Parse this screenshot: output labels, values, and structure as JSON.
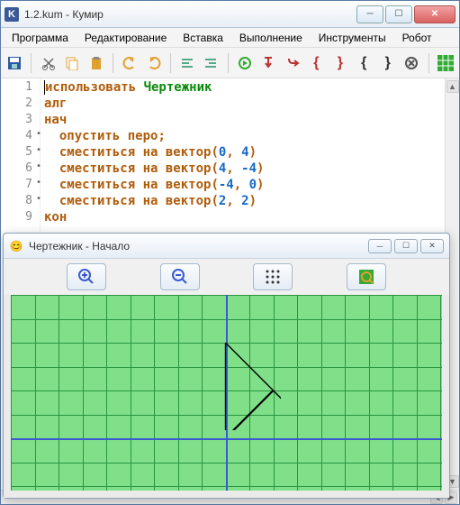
{
  "main_window": {
    "icon_letter": "K",
    "title": "1.2.kum - Кумир"
  },
  "menu": {
    "items": [
      "Программа",
      "Редактирование",
      "Вставка",
      "Выполнение",
      "Инструменты",
      "Робот"
    ]
  },
  "toolbar_icons": [
    "save-icon",
    "cut-icon",
    "copy-icon",
    "paste-icon",
    "undo-icon",
    "redo-icon",
    "indent-left-icon",
    "indent-right-icon",
    "run-icon",
    "step-over-icon",
    "step-into-icon",
    "red-brace-open-icon",
    "red-brace-close-icon",
    "black-brace-open-icon",
    "black-brace-close-icon",
    "cancel-icon",
    "grid-icon"
  ],
  "code": {
    "lines": [
      {
        "n": "1",
        "dot": false,
        "indent": 0,
        "parts": [
          {
            "t": "использовать ",
            "c": "kw"
          },
          {
            "t": "Чертежник",
            "c": "ident"
          }
        ]
      },
      {
        "n": "2",
        "dot": false,
        "indent": 0,
        "parts": [
          {
            "t": "алг",
            "c": "kw"
          }
        ]
      },
      {
        "n": "3",
        "dot": false,
        "indent": 0,
        "parts": [
          {
            "t": "нач",
            "c": "kw"
          }
        ]
      },
      {
        "n": "4",
        "dot": true,
        "indent": 1,
        "parts": [
          {
            "t": "опустить перо",
            "c": "cmd"
          },
          {
            "t": ";",
            "c": "punct"
          }
        ]
      },
      {
        "n": "5",
        "dot": true,
        "indent": 1,
        "parts": [
          {
            "t": "сместиться на вектор",
            "c": "cmd"
          },
          {
            "t": "(",
            "c": "punct"
          },
          {
            "t": "0",
            "c": "num"
          },
          {
            "t": ", ",
            "c": "punct"
          },
          {
            "t": "4",
            "c": "num"
          },
          {
            "t": ")",
            "c": "punct"
          }
        ]
      },
      {
        "n": "6",
        "dot": true,
        "indent": 1,
        "parts": [
          {
            "t": "сместиться на вектор",
            "c": "cmd"
          },
          {
            "t": "(",
            "c": "punct"
          },
          {
            "t": "4",
            "c": "num"
          },
          {
            "t": ", ",
            "c": "punct"
          },
          {
            "t": "-4",
            "c": "num"
          },
          {
            "t": ")",
            "c": "punct"
          }
        ]
      },
      {
        "n": "7",
        "dot": true,
        "indent": 1,
        "parts": [
          {
            "t": "сместиться на вектор",
            "c": "cmd"
          },
          {
            "t": "(",
            "c": "punct"
          },
          {
            "t": "-4",
            "c": "num"
          },
          {
            "t": ", ",
            "c": "punct"
          },
          {
            "t": "0",
            "c": "num"
          },
          {
            "t": ")",
            "c": "punct"
          }
        ]
      },
      {
        "n": "8",
        "dot": true,
        "indent": 1,
        "parts": [
          {
            "t": "сместиться на вектор",
            "c": "cmd"
          },
          {
            "t": "(",
            "c": "punct"
          },
          {
            "t": "2",
            "c": "num"
          },
          {
            "t": ", ",
            "c": "punct"
          },
          {
            "t": "2",
            "c": "num"
          },
          {
            "t": ")",
            "c": "punct"
          }
        ]
      },
      {
        "n": "9",
        "dot": false,
        "indent": 0,
        "parts": [
          {
            "t": "кон",
            "c": "kw"
          }
        ]
      }
    ]
  },
  "child_window": {
    "title": "Чертежник - Начало",
    "toolbar": [
      "zoom-in-icon",
      "zoom-out-icon",
      "grid-toggle-icon",
      "fit-icon"
    ]
  }
}
